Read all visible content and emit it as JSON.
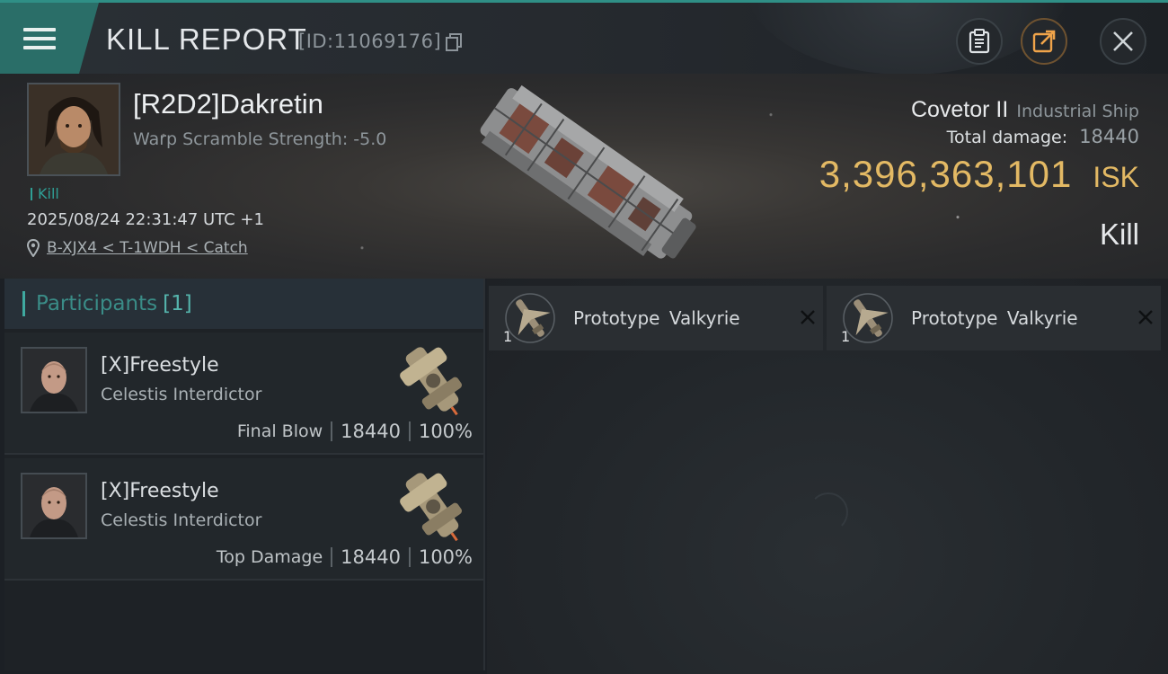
{
  "header": {
    "title": "KILL REPORT",
    "report_id": "[ID:11069176]",
    "icons": {
      "menu": "hamburger-icon",
      "copy": "copy-icon",
      "clipboard": "clipboard-icon",
      "share": "share-icon",
      "close": "close-icon"
    }
  },
  "victim": {
    "name": "[R2D2]Dakretin",
    "warp_scramble": "Warp Scramble Strength: -5.0",
    "kill_count": "Kill",
    "timestamp": "2025/08/24 22:31:47 UTC +1",
    "location": "B-XJX4 < T-1WDH < Catch",
    "ship_name": "Covetor II",
    "ship_class": "Industrial Ship",
    "damage_label": "Total damage:",
    "damage_value": "18440",
    "isk_value": "3,396,363,101",
    "isk_unit": "ISK",
    "kill_type": "Kill"
  },
  "participants": {
    "label": "Participants",
    "count": "[1]",
    "rows": [
      {
        "name": "[X]Freestyle",
        "ship": "Celestis Interdictor",
        "role": "Final Blow",
        "damage": "18440",
        "percent": "100%"
      },
      {
        "name": "[X]Freestyle",
        "ship": "Celestis Interdictor",
        "role": "Top Damage",
        "damage": "18440",
        "percent": "100%"
      }
    ]
  },
  "modules": [
    {
      "name": "Prototype  Valkyrie",
      "qty": "1"
    },
    {
      "name": "Prototype  Valkyrie",
      "qty": "1"
    }
  ],
  "colors": {
    "accent": "#2f8f86",
    "isk": "#e3b964",
    "background": "#1c2025"
  }
}
